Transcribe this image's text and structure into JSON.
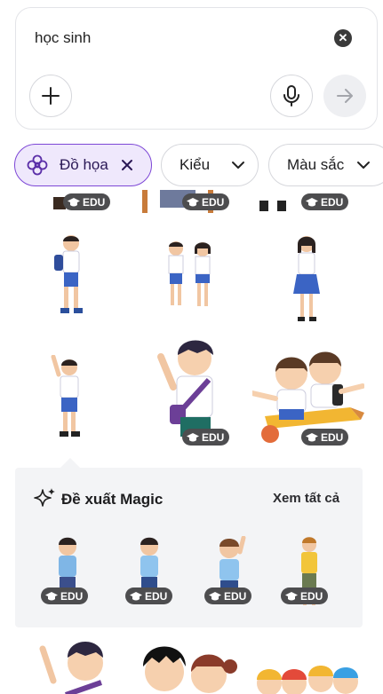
{
  "search": {
    "query": "học sinh"
  },
  "filters": {
    "graphics_label": "Đồ họa",
    "style_label": "Kiểu",
    "color_label": "Màu sắc"
  },
  "badges": {
    "edu": "EDU"
  },
  "magic": {
    "title": "Đề xuất Magic",
    "see_all": "Xem tất cả"
  },
  "colors": {
    "accent_purple": "#7d47d6",
    "chip_selected_bg": "#efe8fc",
    "badge_bg": "#4d4d4f",
    "panel_bg": "#f3f4f6",
    "shirt_white": "#ffffff",
    "shorts_blue": "#3b64c4"
  },
  "icons": [
    "close-icon",
    "plus-icon",
    "mic-icon",
    "arrow-right-icon",
    "flower-icon",
    "chevron-down-icon",
    "sparkle-icon",
    "graduation-cap-icon"
  ]
}
